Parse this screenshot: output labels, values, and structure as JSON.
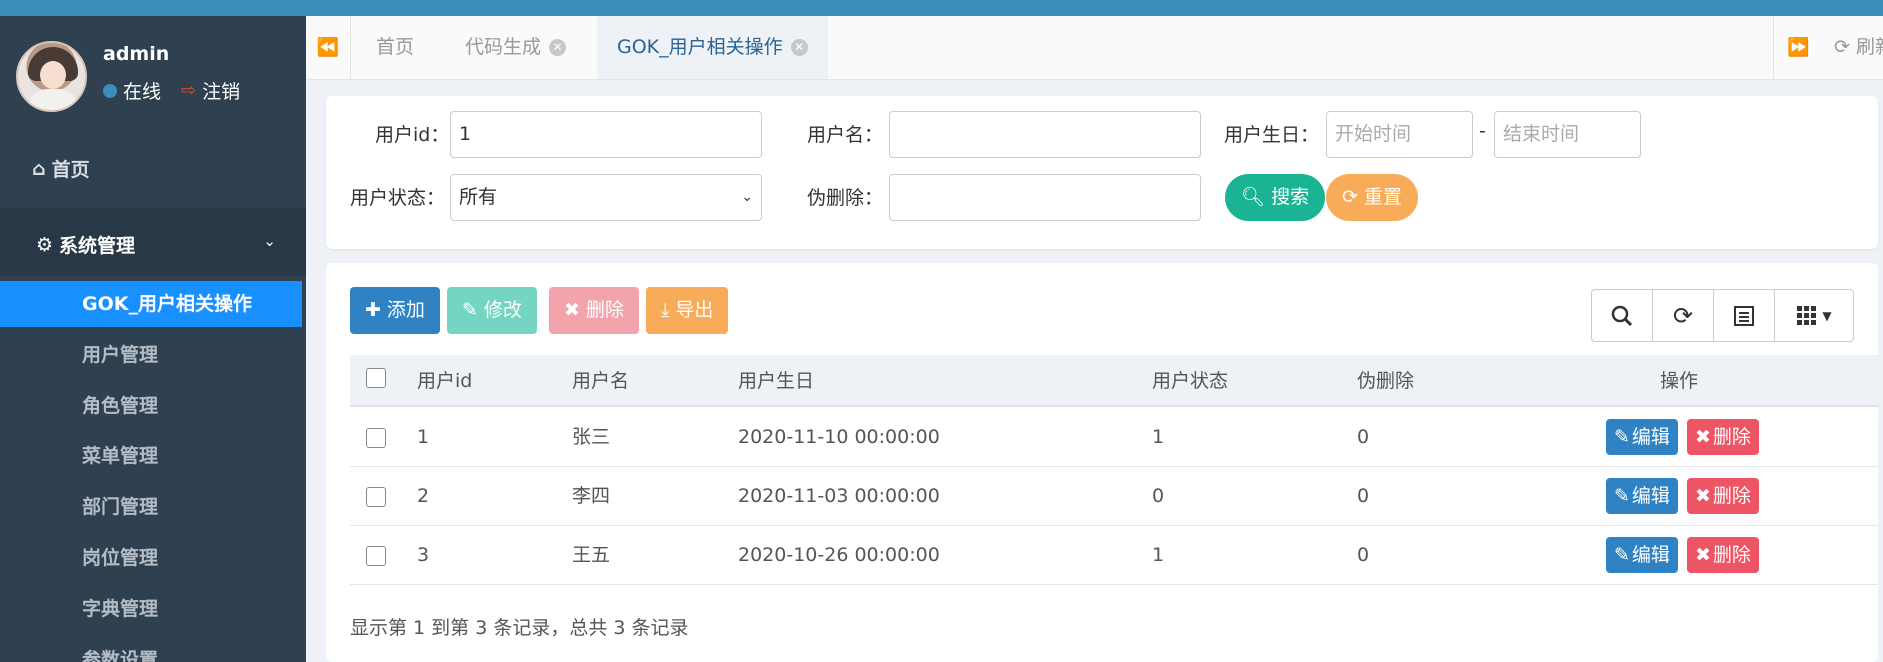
{
  "sidebar": {
    "user": {
      "name": "admin",
      "status": "在线",
      "logout": "注销"
    },
    "home": "首页",
    "group": "系统管理",
    "items": [
      {
        "label": "GOK_用户相关操作",
        "active": true
      },
      {
        "label": "用户管理"
      },
      {
        "label": "角色管理"
      },
      {
        "label": "菜单管理"
      },
      {
        "label": "部门管理"
      },
      {
        "label": "岗位管理"
      },
      {
        "label": "字典管理"
      },
      {
        "label": "参数设置"
      }
    ]
  },
  "tabs": {
    "items": [
      {
        "label": "首页"
      },
      {
        "label": "代码生成"
      },
      {
        "label": "GOK_用户相关操作"
      }
    ],
    "refresh": "刷新"
  },
  "search": {
    "userid_label": "用户id：",
    "userid_value": "1",
    "username_label": "用户名：",
    "username_value": "",
    "birthday_label": "用户生日：",
    "start_placeholder": "开始时间",
    "end_placeholder": "结束时间",
    "range_sep": "-",
    "status_label": "用户状态：",
    "status_value": "所有",
    "deleted_label": "伪删除：",
    "deleted_value": "",
    "search_btn": "搜索",
    "reset_btn": "重置"
  },
  "toolbar": {
    "add": "添加",
    "edit": "修改",
    "delete": "删除",
    "export": "导出"
  },
  "table": {
    "headers": [
      "用户id",
      "用户名",
      "用户生日",
      "用户状态",
      "伪删除",
      "操作"
    ],
    "rows": [
      {
        "id": "1",
        "name": "张三",
        "birthday": "2020-11-10 00:00:00",
        "status": "1",
        "deleted": "0"
      },
      {
        "id": "2",
        "name": "李四",
        "birthday": "2020-11-03 00:00:00",
        "status": "0",
        "deleted": "0"
      },
      {
        "id": "3",
        "name": "王五",
        "birthday": "2020-10-26 00:00:00",
        "status": "1",
        "deleted": "0"
      }
    ],
    "edit_label": "编辑",
    "delete_label": "删除",
    "footer": "显示第 1 到第 3 条记录，总共 3 条记录"
  },
  "colors": {
    "primary": "#2f83c4",
    "success": "#1ab394",
    "warning": "#f8ac59",
    "danger": "#ed5565",
    "sidebar": "#2f4050",
    "active": "#1890ff"
  }
}
